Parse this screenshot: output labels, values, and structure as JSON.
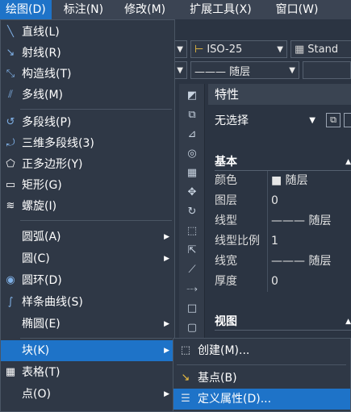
{
  "menubar": [
    {
      "label": "绘图(D)",
      "active": true
    },
    {
      "label": "标注(N)",
      "active": false
    },
    {
      "label": "修改(M)",
      "active": false
    },
    {
      "label": "扩展工具(X)",
      "active": false
    },
    {
      "label": "窗口(W)",
      "active": false
    }
  ],
  "toolbar": {
    "dimstyle": "ISO-25",
    "textstyle": "Stand",
    "linetype": "——— 随层"
  },
  "properties": {
    "title": "特性",
    "selection": "无选择",
    "section_basic": "基本",
    "rows": [
      {
        "key": "颜色",
        "value": "■ 随层"
      },
      {
        "key": "图层",
        "value": "0"
      },
      {
        "key": "线型",
        "value": "——— 随层"
      },
      {
        "key": "线型比例",
        "value": "1"
      },
      {
        "key": "线宽",
        "value": "——— 随层"
      },
      {
        "key": "厚度",
        "value": "0"
      }
    ],
    "section_view": "视图"
  },
  "draw_menu": [
    {
      "label": "直线(L)",
      "icon": "line-icon"
    },
    {
      "label": "射线(R)",
      "icon": "ray-icon"
    },
    {
      "label": "构造线(T)",
      "icon": "xline-icon"
    },
    {
      "label": "多线(M)",
      "icon": "mline-icon"
    },
    {
      "label": "多段线(P)",
      "icon": "polyline-icon"
    },
    {
      "label": "三维多段线(3)",
      "icon": "3dpolyline-icon"
    },
    {
      "label": "正多边形(Y)",
      "icon": "polygon-icon"
    },
    {
      "label": "矩形(G)",
      "icon": "rectangle-icon"
    },
    {
      "label": "螺旋(I)",
      "icon": "helix-icon"
    },
    {
      "label": "圆弧(A)",
      "icon": "",
      "submenu": true
    },
    {
      "label": "圆(C)",
      "icon": "",
      "submenu": true
    },
    {
      "label": "圆环(D)",
      "icon": "donut-icon"
    },
    {
      "label": "样条曲线(S)",
      "icon": "spline-icon"
    },
    {
      "label": "椭圆(E)",
      "icon": "",
      "submenu": true
    },
    {
      "label": "块(K)",
      "icon": "",
      "submenu": true,
      "active": true
    },
    {
      "label": "表格(T)",
      "icon": "table-icon"
    },
    {
      "label": "点(O)",
      "icon": "",
      "submenu": true
    }
  ],
  "block_submenu": [
    {
      "label": "创建(M)...",
      "icon": "block-create-icon"
    },
    {
      "label": "基点(B)",
      "icon": "basepoint-icon"
    },
    {
      "label": "定义属性(D)...",
      "icon": "attdef-icon",
      "active": true
    }
  ]
}
